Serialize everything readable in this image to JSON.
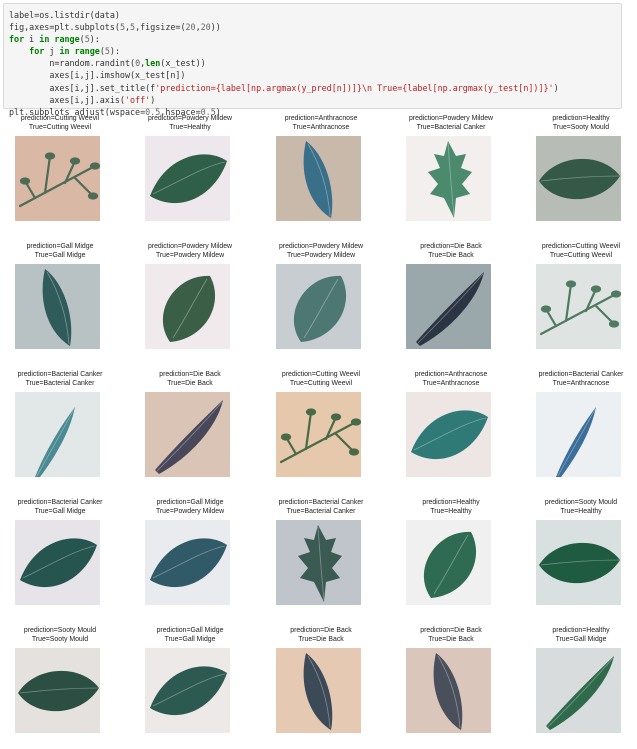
{
  "code_cell": {
    "lines": [
      "label=os.listdir(data)",
      "fig,axes=plt.subplots(5,5,figsize=(20,20))",
      "for i in range(5):",
      "    for j in range(5):",
      "        n=random.randint(0,len(x_test))",
      "        axes[i,j].imshow(x_test[n])",
      "        axes[i,j].set_title(f'prediction={label[np.argmax(y_pred[n])]}\\n True={label[np.argmax(y_test[n])]}')",
      "        axes[i,j].axis('off')",
      "plt.subplots_adjust(wspace=0.5,hspace=0.5)"
    ]
  },
  "prediction_grid": [
    [
      {
        "prediction": "prediction=Cutting Weevil",
        "true": "True=Cutting Weevil",
        "bg": "#d9b9a5",
        "leaf": "#4e6b55",
        "shape": "branch"
      },
      {
        "prediction": "prediction=Powdery Mildew",
        "true": "True=Healthy",
        "bg": "#eee8ec",
        "leaf": "#2f5f48",
        "shape": "wide"
      },
      {
        "prediction": "prediction=Anthracnose",
        "true": "True=Anthracnose",
        "bg": "#c9b9aa",
        "leaf": "#3a6f8a",
        "shape": "long"
      },
      {
        "prediction": "prediction=Powdery Mildew",
        "true": "True=Bacterial Canker",
        "bg": "#f3efee",
        "leaf": "#4c8a6e",
        "shape": "serrated"
      },
      {
        "prediction": "prediction=Healthy",
        "true": "True=Sooty Mould",
        "bg": "#b7bcb6",
        "leaf": "#345a47",
        "shape": "broad"
      }
    ],
    [
      {
        "prediction": "prediction=Gall Midge",
        "true": "True=Gall Midge",
        "bg": "#b8c2c4",
        "leaf": "#2f5b5a",
        "shape": "long"
      },
      {
        "prediction": "prediction=Powdery Mildew",
        "true": "True=Powdery Mildew",
        "bg": "#f0eaec",
        "leaf": "#3a5f46",
        "shape": "oval"
      },
      {
        "prediction": "prediction=Powdery Mildew",
        "true": "True=Powdery Mildew",
        "bg": "#c7cdd0",
        "leaf": "#4d7772",
        "shape": "oval"
      },
      {
        "prediction": "prediction=Die Back",
        "true": "True=Die Back",
        "bg": "#9aa7ab",
        "leaf": "#2a3443",
        "shape": "diag"
      },
      {
        "prediction": "prediction=Cutting Weevil",
        "true": "True=Cutting Weevil",
        "bg": "#dfe4e3",
        "leaf": "#4f7b62",
        "shape": "branch"
      }
    ],
    [
      {
        "prediction": "prediction=Bacterial Canker",
        "true": "True=Bacterial Canker",
        "bg": "#e2e7e8",
        "leaf": "#4b8a92",
        "shape": "thin"
      },
      {
        "prediction": "prediction=Die Back",
        "true": "True=Die Back",
        "bg": "#d9c4b5",
        "leaf": "#48485a",
        "shape": "diag"
      },
      {
        "prediction": "prediction=Cutting Weevil",
        "true": "True=Cutting Weevil",
        "bg": "#e6c8ad",
        "leaf": "#486b45",
        "shape": "branch"
      },
      {
        "prediction": "prediction=Anthracnose",
        "true": "True=Anthracnose",
        "bg": "#eee6e4",
        "leaf": "#2f7a76",
        "shape": "wide"
      },
      {
        "prediction": "prediction=Bacterial Canker",
        "true": "True=Anthracnose",
        "bg": "#edf0f2",
        "leaf": "#3b6f9a",
        "shape": "thin"
      }
    ],
    [
      {
        "prediction": "prediction=Bacterial Canker",
        "true": "True=Gall Midge",
        "bg": "#e6e4e8",
        "leaf": "#26544f",
        "shape": "wide"
      },
      {
        "prediction": "prediction=Gall Midge",
        "true": "True=Powdery Mildew",
        "bg": "#e9ebef",
        "leaf": "#315a68",
        "shape": "wide"
      },
      {
        "prediction": "prediction=Bacterial Canker",
        "true": "True=Bacterial Canker",
        "bg": "#bfc5ca",
        "leaf": "#3a5a52",
        "shape": "serrated"
      },
      {
        "prediction": "prediction=Healthy",
        "true": "True=Healthy",
        "bg": "#f1f0f0",
        "leaf": "#2f6b52",
        "shape": "oval"
      },
      {
        "prediction": "prediction=Sooty Mould",
        "true": "True=Healthy",
        "bg": "#d8e1df",
        "leaf": "#1f5b41",
        "shape": "broad"
      }
    ],
    [
      {
        "prediction": "prediction=Sooty Mould",
        "true": "True=Sooty Mould",
        "bg": "#e5e1df",
        "leaf": "#2c4f44",
        "shape": "broad"
      },
      {
        "prediction": "prediction=Gall Midge",
        "true": "True=Gall Midge",
        "bg": "#ede9e8",
        "leaf": "#2d5a50",
        "shape": "wide"
      },
      {
        "prediction": "prediction=Die Back",
        "true": "True=Die Back",
        "bg": "#e6c9b2",
        "leaf": "#3c4a58",
        "shape": "long"
      },
      {
        "prediction": "prediction=Die Back",
        "true": "True=Die Back",
        "bg": "#dac6bb",
        "leaf": "#4a4f5c",
        "shape": "long"
      },
      {
        "prediction": "prediction=Healthy",
        "true": "True=Gall Midge",
        "bg": "#d9dcdc",
        "leaf": "#2f6a4c",
        "shape": "diag"
      }
    ]
  ]
}
